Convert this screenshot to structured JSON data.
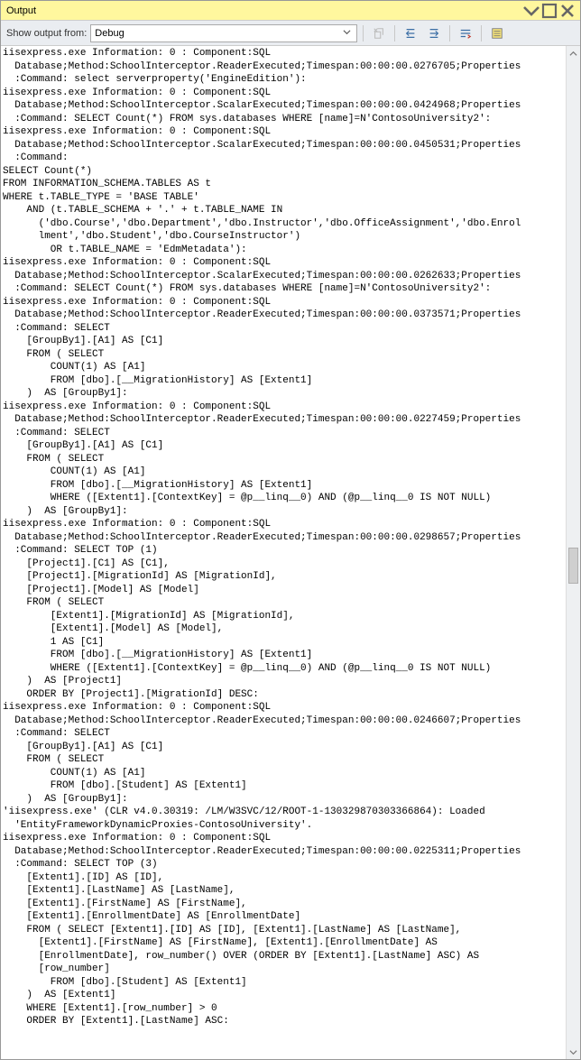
{
  "panel": {
    "title": "Output"
  },
  "toolbar": {
    "label": "Show output from:",
    "dropdown": "Debug"
  },
  "log": "iisexpress.exe Information: 0 : Component:SQL\n  Database;Method:SchoolInterceptor.ReaderExecuted;Timespan:00:00:00.0276705;Properties\n  :Command: select serverproperty('EngineEdition'):\niisexpress.exe Information: 0 : Component:SQL\n  Database;Method:SchoolInterceptor.ScalarExecuted;Timespan:00:00:00.0424968;Properties\n  :Command: SELECT Count(*) FROM sys.databases WHERE [name]=N'ContosoUniversity2':\niisexpress.exe Information: 0 : Component:SQL\n  Database;Method:SchoolInterceptor.ScalarExecuted;Timespan:00:00:00.0450531;Properties\n  :Command:\nSELECT Count(*)\nFROM INFORMATION_SCHEMA.TABLES AS t\nWHERE t.TABLE_TYPE = 'BASE TABLE'\n    AND (t.TABLE_SCHEMA + '.' + t.TABLE_NAME IN\n      ('dbo.Course','dbo.Department','dbo.Instructor','dbo.OfficeAssignment','dbo.Enrol\n      lment','dbo.Student','dbo.CourseInstructor')\n        OR t.TABLE_NAME = 'EdmMetadata'):\niisexpress.exe Information: 0 : Component:SQL\n  Database;Method:SchoolInterceptor.ScalarExecuted;Timespan:00:00:00.0262633;Properties\n  :Command: SELECT Count(*) FROM sys.databases WHERE [name]=N'ContosoUniversity2':\niisexpress.exe Information: 0 : Component:SQL\n  Database;Method:SchoolInterceptor.ReaderExecuted;Timespan:00:00:00.0373571;Properties\n  :Command: SELECT\n    [GroupBy1].[A1] AS [C1]\n    FROM ( SELECT\n        COUNT(1) AS [A1]\n        FROM [dbo].[__MigrationHistory] AS [Extent1]\n    )  AS [GroupBy1]:\niisexpress.exe Information: 0 : Component:SQL\n  Database;Method:SchoolInterceptor.ReaderExecuted;Timespan:00:00:00.0227459;Properties\n  :Command: SELECT\n    [GroupBy1].[A1] AS [C1]\n    FROM ( SELECT\n        COUNT(1) AS [A1]\n        FROM [dbo].[__MigrationHistory] AS [Extent1]\n        WHERE ([Extent1].[ContextKey] = @p__linq__0) AND (@p__linq__0 IS NOT NULL)\n    )  AS [GroupBy1]:\niisexpress.exe Information: 0 : Component:SQL\n  Database;Method:SchoolInterceptor.ReaderExecuted;Timespan:00:00:00.0298657;Properties\n  :Command: SELECT TOP (1)\n    [Project1].[C1] AS [C1],\n    [Project1].[MigrationId] AS [MigrationId],\n    [Project1].[Model] AS [Model]\n    FROM ( SELECT\n        [Extent1].[MigrationId] AS [MigrationId],\n        [Extent1].[Model] AS [Model],\n        1 AS [C1]\n        FROM [dbo].[__MigrationHistory] AS [Extent1]\n        WHERE ([Extent1].[ContextKey] = @p__linq__0) AND (@p__linq__0 IS NOT NULL)\n    )  AS [Project1]\n    ORDER BY [Project1].[MigrationId] DESC:\niisexpress.exe Information: 0 : Component:SQL\n  Database;Method:SchoolInterceptor.ReaderExecuted;Timespan:00:00:00.0246607;Properties\n  :Command: SELECT\n    [GroupBy1].[A1] AS [C1]\n    FROM ( SELECT\n        COUNT(1) AS [A1]\n        FROM [dbo].[Student] AS [Extent1]\n    )  AS [GroupBy1]:\n'iisexpress.exe' (CLR v4.0.30319: /LM/W3SVC/12/ROOT-1-130329870303366864): Loaded\n  'EntityFrameworkDynamicProxies-ContosoUniversity'.\niisexpress.exe Information: 0 : Component:SQL\n  Database;Method:SchoolInterceptor.ReaderExecuted;Timespan:00:00:00.0225311;Properties\n  :Command: SELECT TOP (3)\n    [Extent1].[ID] AS [ID],\n    [Extent1].[LastName] AS [LastName],\n    [Extent1].[FirstName] AS [FirstName],\n    [Extent1].[EnrollmentDate] AS [EnrollmentDate]\n    FROM ( SELECT [Extent1].[ID] AS [ID], [Extent1].[LastName] AS [LastName],\n      [Extent1].[FirstName] AS [FirstName], [Extent1].[EnrollmentDate] AS\n      [EnrollmentDate], row_number() OVER (ORDER BY [Extent1].[LastName] ASC) AS\n      [row_number]\n        FROM [dbo].[Student] AS [Extent1]\n    )  AS [Extent1]\n    WHERE [Extent1].[row_number] > 0\n    ORDER BY [Extent1].[LastName] ASC:"
}
